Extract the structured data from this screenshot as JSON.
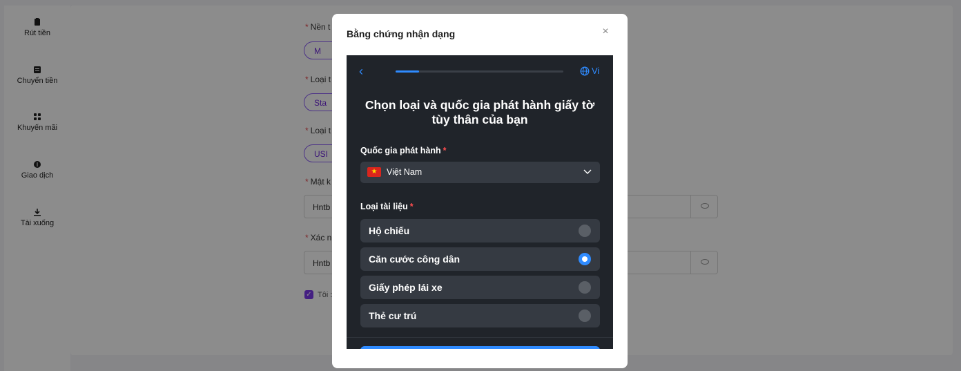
{
  "sidebar": {
    "items": [
      {
        "label": "Rút tiền",
        "icon": "clipboard-icon"
      },
      {
        "label": "Chuyển tiền",
        "icon": "transfer-icon"
      },
      {
        "label": "Khuyến mãi",
        "icon": "grid-icon"
      },
      {
        "label": "Giao dịch",
        "icon": "dollar-icon"
      },
      {
        "label": "Tài xuống",
        "icon": "download-icon"
      }
    ]
  },
  "form": {
    "platform_label": "Nền t",
    "platform_value": "M",
    "account_type_label": "Loại t",
    "account_type_value": "Sta",
    "currency_label": "Loại t",
    "currency_value": "USI",
    "password_label": "Mật k",
    "password_value": "Hntb",
    "confirm_label": "Xác n",
    "confirm_value": "Hntb",
    "agree_label": "Tôi :"
  },
  "modal": {
    "title": "Bằng chứng nhận dạng",
    "close_glyph": "×"
  },
  "kyc": {
    "lang_label": "Vi",
    "progress": 0.14,
    "heading": "Chọn loại và quốc gia phát hành giấy tờ tùy thân của bạn",
    "country_label": "Quốc gia phát hành",
    "country_value": "Việt Nam",
    "doc_label": "Loại tài liệu",
    "required_mark": "*",
    "options": [
      {
        "label": "Hộ chiếu",
        "selected": false
      },
      {
        "label": "Căn cước công dân",
        "selected": true
      },
      {
        "label": "Giấy phép lái xe",
        "selected": false
      },
      {
        "label": "Thẻ cư trú",
        "selected": false
      }
    ]
  },
  "colors": {
    "accent": "#2f8bff",
    "kyc_bg": "#20242a",
    "option_bg": "#353a42",
    "brand_purple": "#7c3aed",
    "required": "#ff4d4f"
  }
}
